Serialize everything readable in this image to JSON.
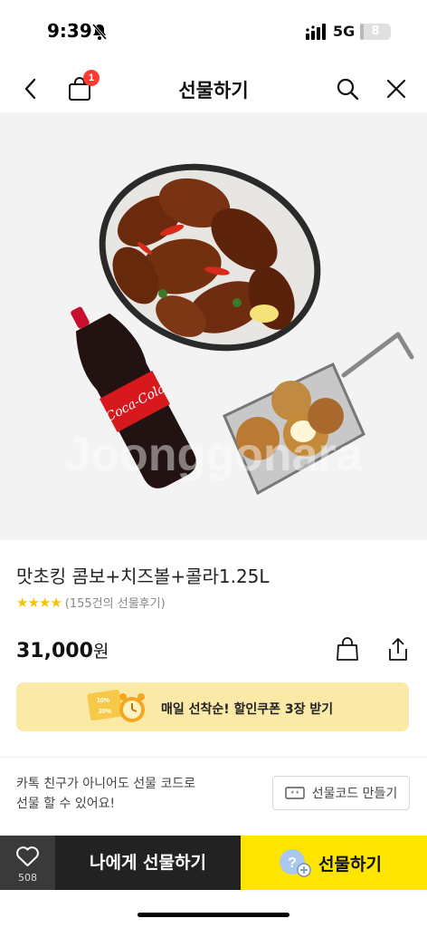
{
  "status_bar": {
    "time": "9:39",
    "network": "5G",
    "battery": "8",
    "battery_level": 0.08
  },
  "header": {
    "title": "선물하기",
    "cart_badge": "1"
  },
  "product": {
    "name": "맛초킹 콤보+치즈볼+콜라1.25L",
    "stars": "★★★★",
    "review_count": "(155건의 선물후기)",
    "price": "31,000",
    "price_unit": "원",
    "image_watermark": "Joonggonara",
    "bottle_label": "Coca-Cola"
  },
  "coupon": {
    "text": "매일 선착순! 할인쿠폰 3장 받기",
    "graphic_text_top": "10%",
    "graphic_text_bottom": "20%"
  },
  "friend_info": {
    "line1": "카톡 친구가 아니어도 선물 코드로",
    "line2": "선물 할 수 있어요!",
    "gift_code_button": "선물코드 만들기",
    "gift_code_icon_text": "**"
  },
  "bottom_bar": {
    "like_count": "508",
    "gift_self_label": "나에게 선물하기",
    "gift_label": "선물하기",
    "gift_icon_text": "?"
  },
  "colors": {
    "kakao_yellow": "#fee500",
    "badge_red": "#ff3b30",
    "coupon_bg": "#fbe9a7",
    "star_yellow": "#f5c400"
  }
}
